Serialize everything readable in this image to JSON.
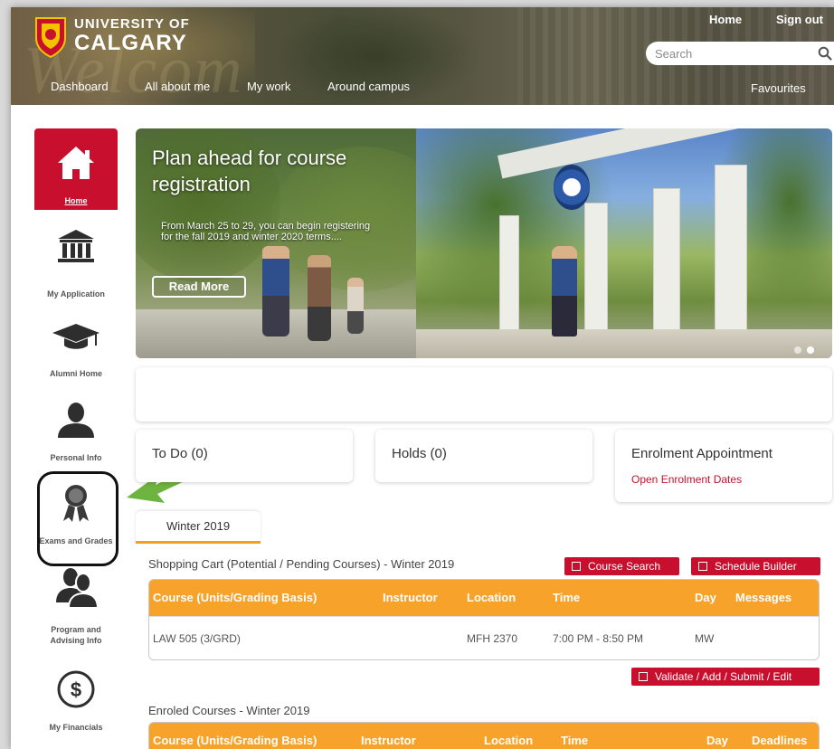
{
  "header": {
    "university_line1": "UNIVERSITY OF",
    "university_line2": "CALGARY",
    "home_link": "Home",
    "signout_link": "Sign out",
    "search_placeholder": "Search",
    "nav": [
      "Dashboard",
      "All about me",
      "My work",
      "Around campus"
    ],
    "favourites": "Favourites"
  },
  "sidebar": {
    "items": [
      {
        "label": "Home",
        "icon": "home-icon",
        "active": true
      },
      {
        "label": "My Application",
        "icon": "institution-icon"
      },
      {
        "label": "Alumni Home",
        "icon": "graduation-cap-icon"
      },
      {
        "label": "Personal Info",
        "icon": "person-icon"
      },
      {
        "label": "Exams and Grades",
        "icon": "award-ribbon-icon"
      },
      {
        "label": "Program and Advising Info",
        "icon": "people-icon"
      },
      {
        "label": "My Financials",
        "icon": "dollar-coin-icon"
      }
    ]
  },
  "banner": {
    "title": "Plan ahead for course registration",
    "subtitle": "From March 25 to 29, you can begin registering for the fall 2019 and winter 2020 terms....",
    "button": "Read More"
  },
  "cards": {
    "todo": "To Do (0)",
    "holds": "Holds (0)",
    "enrolment_title": "Enrolment Appointment",
    "enrolment_link": "Open Enrolment Dates"
  },
  "term_tab": "Winter 2019",
  "shopping_cart": {
    "label": "Shopping Cart (Potential / Pending Courses) - Winter 2019",
    "course_search": "Course Search",
    "schedule_builder": "Schedule Builder",
    "columns": [
      "Course (Units/Grading Basis)",
      "Instructor",
      "Location",
      "Time",
      "Day",
      "Messages"
    ],
    "rows": [
      {
        "course": "LAW 505 (3/GRD)",
        "instructor": "",
        "location": "MFH 2370",
        "time": "7:00 PM - 8:50 PM",
        "day": "MW",
        "messages": ""
      }
    ],
    "validate_button": "Validate / Add / Submit / Edit"
  },
  "enrolled": {
    "label": "Enroled Courses - Winter 2019",
    "columns": [
      "Course (Units/Grading Basis)",
      "Instructor",
      "Location",
      "Time",
      "Day",
      "Deadlines"
    ]
  },
  "colors": {
    "brand_red": "#c8102e",
    "table_header_orange": "#f7a22a",
    "annotation_green": "#6db33f"
  }
}
